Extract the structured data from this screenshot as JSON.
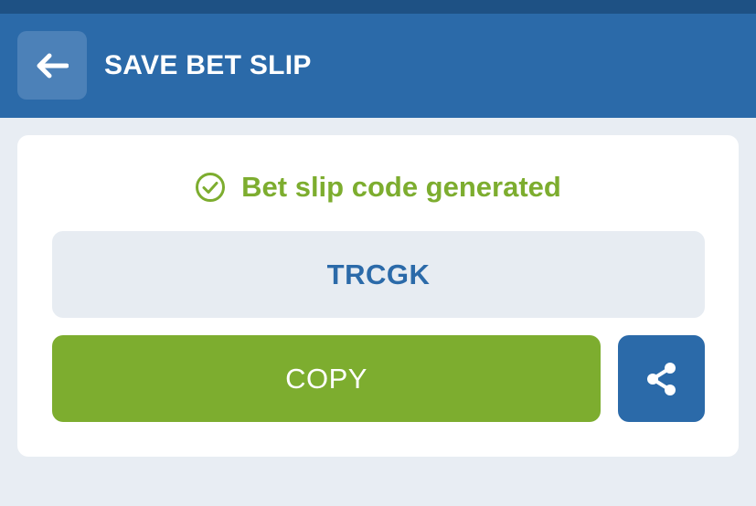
{
  "header": {
    "title": "SAVE BET SLIP",
    "back_icon": "arrow-left-icon"
  },
  "card": {
    "status_text": "Bet slip code generated",
    "status_icon": "check-circle-icon",
    "code": "TRCGK",
    "copy_label": "COPY",
    "share_icon": "share-icon"
  },
  "colors": {
    "header_bg": "#2b6aa9",
    "status_strip": "#1e5184",
    "accent_green": "#7dad2f",
    "code_text": "#2b6aa9",
    "code_bg": "#e7ecf2",
    "page_bg": "#e8edf3"
  }
}
